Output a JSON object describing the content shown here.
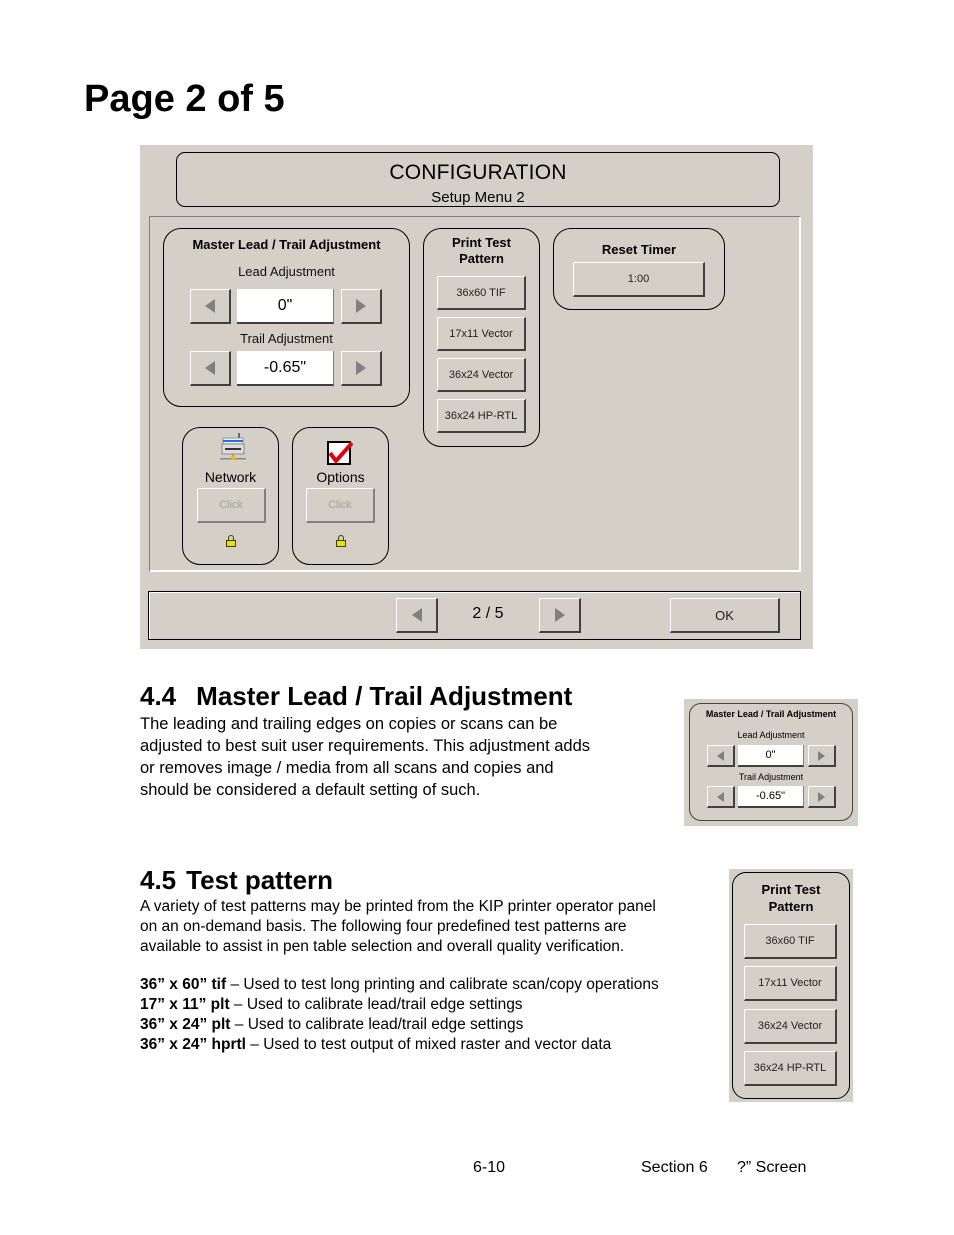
{
  "page_title": "Page 2 of 5",
  "config_screen": {
    "title": "CONFIGURATION",
    "subtitle": "Setup Menu 2",
    "master_lead_trail": {
      "title": "Master Lead / Trail Adjustment",
      "lead_label": "Lead Adjustment",
      "lead_value": "0\"",
      "trail_label": "Trail Adjustment",
      "trail_value": "-0.65\""
    },
    "print_test_pattern": {
      "title_line1": "Print Test",
      "title_line2": "Pattern",
      "buttons": [
        "36x60 TIF",
        "17x11 Vector",
        "36x24 Vector",
        "36x24 HP-RTL"
      ]
    },
    "reset_timer": {
      "title": "Reset Timer",
      "value": "1:00"
    },
    "network": {
      "label": "Network",
      "button": "Click",
      "icon": "network-printer-icon",
      "locked": true
    },
    "options": {
      "label": "Options",
      "button": "Click",
      "icon": "checkbox-checked-icon",
      "locked": true
    },
    "nav": {
      "page_indicator": "2 / 5",
      "ok_label": "OK"
    }
  },
  "section_4_4": {
    "heading_num": "4.4",
    "heading_text": "Master Lead / Trail Adjustment",
    "lines": [
      "The leading and trailing edges on copies or scans can be",
      "adjusted to best suit user requirements. This adjustment adds",
      "or removes image / media from all scans and copies and",
      "should be considered a default setting of such."
    ]
  },
  "section_4_5": {
    "heading_num": "4.5",
    "heading_text": "Test pattern",
    "lines": [
      "A variety of test patterns may be printed from the KIP printer operator panel",
      "on an on-demand basis.  The following four predefined test patterns are",
      "available to assist in pen table selection and overall quality verification."
    ],
    "patterns": [
      {
        "name": "36” x 60” tif",
        "desc": " – Used to test long printing and calibrate scan/copy operations"
      },
      {
        "name": "17” x 11” plt",
        "desc": " – Used to calibrate lead/trail edge settings"
      },
      {
        "name": "36” x 24” plt",
        "desc": " – Used to calibrate lead/trail edge settings"
      },
      {
        "name": "36” x 24” hprtl",
        "desc": " – Used to test output of mixed raster and vector data"
      }
    ]
  },
  "footer": {
    "page_number": "6-10",
    "section": "Section 6",
    "screen": "?” Screen"
  }
}
